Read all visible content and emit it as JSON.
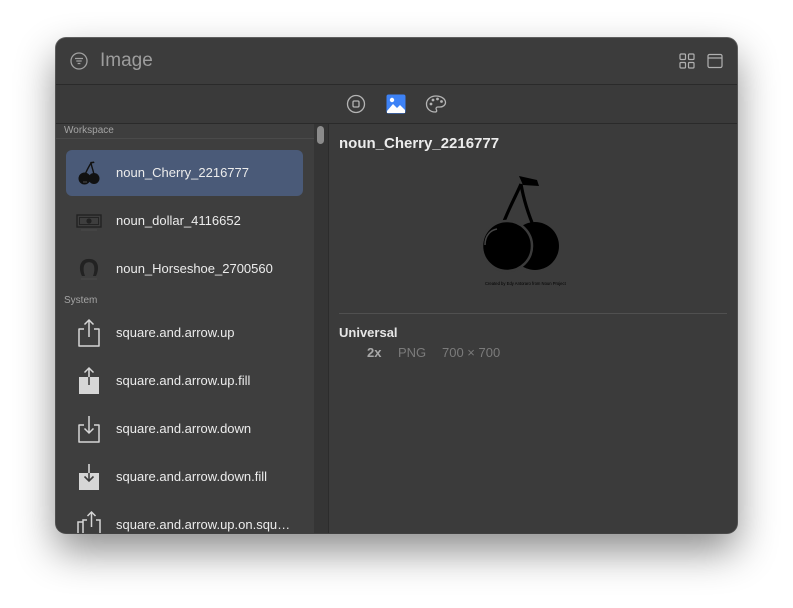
{
  "window": {
    "title": "Image"
  },
  "toolbar": {
    "tabs": [
      "symbol-tab",
      "image-tab",
      "color-tab"
    ],
    "active_tab": "image-tab",
    "accent_color": "#3d82f6"
  },
  "sidebar": {
    "workspace_label": "Workspace",
    "system_label": "System",
    "workspace_items": [
      {
        "label": "noun_Cherry_2216777",
        "icon": "cherry-icon",
        "selected": true
      },
      {
        "label": "noun_dollar_4116652",
        "icon": "dollar-icon",
        "selected": false
      },
      {
        "label": "noun_Horseshoe_2700560",
        "icon": "horseshoe-icon",
        "selected": false
      }
    ],
    "system_items": [
      {
        "label": "square.and.arrow.up",
        "icon": "share-up-icon"
      },
      {
        "label": "square.and.arrow.up.fill",
        "icon": "share-up-fill-icon"
      },
      {
        "label": "square.and.arrow.down",
        "icon": "share-down-icon"
      },
      {
        "label": "square.and.arrow.down.fill",
        "icon": "share-down-fill-icon"
      },
      {
        "label": "square.and.arrow.up.on.squ…",
        "icon": "share-up-on-square-icon"
      }
    ]
  },
  "detail": {
    "title": "noun_Cherry_2216777",
    "preview_caption": "Created by Edy Antoraro from Noun Project",
    "section": "Universal",
    "variant": {
      "scale": "2x",
      "format": "PNG",
      "size": "700 × 700"
    }
  }
}
